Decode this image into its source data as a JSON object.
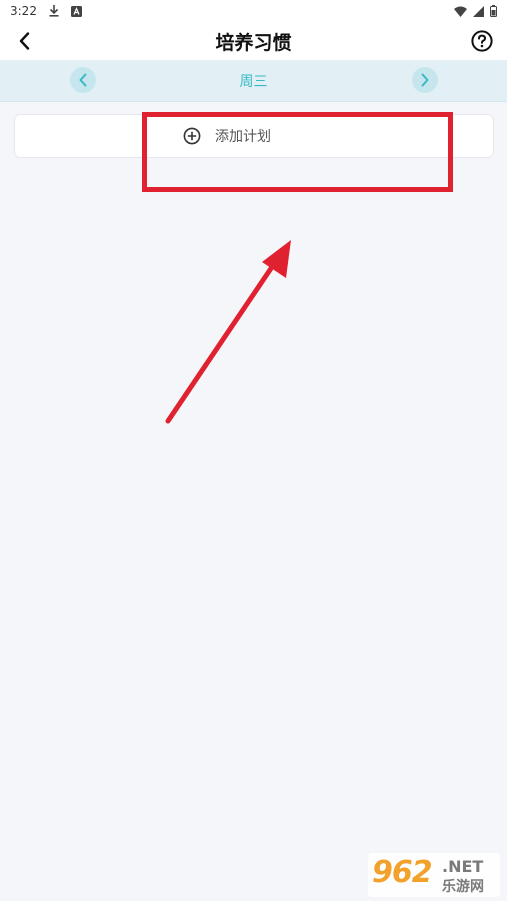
{
  "status_bar": {
    "time": "3:22",
    "icons": [
      "download-icon",
      "a-box-icon",
      "wifi-icon",
      "signal-icon",
      "battery-icon"
    ]
  },
  "header": {
    "title": "培养习惯",
    "back_icon": "back-chevron-icon",
    "help_icon": "help-circle-icon"
  },
  "day_nav": {
    "day": "周三",
    "prev_icon": "chevron-left-icon",
    "next_icon": "chevron-right-icon",
    "accent_color": "#37b8c3"
  },
  "plan": {
    "add_label": "添加计划",
    "add_icon": "plus-circle-icon"
  },
  "annotation": {
    "highlight_color": "#e0212f"
  },
  "watermark": {
    "digits": "962",
    "domain": ".NET",
    "site_name": "乐游网"
  }
}
